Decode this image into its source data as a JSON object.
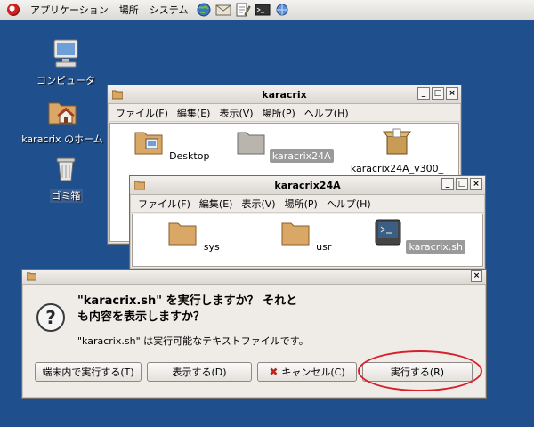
{
  "panel": {
    "menus": [
      "アプリケーション",
      "場所",
      "システム"
    ],
    "launchers": [
      "web-browser-icon",
      "email-icon",
      "text-editor-icon",
      "terminal-icon",
      "network-icon"
    ]
  },
  "desktop": {
    "icons": [
      {
        "label": "コンピュータ",
        "icon": "computer-icon"
      },
      {
        "label": "karacrix のホーム",
        "icon": "home-folder-icon"
      },
      {
        "label": "ゴミ箱",
        "icon": "trash-icon"
      }
    ]
  },
  "win1": {
    "title": "karacrix",
    "menu": [
      "ファイル(F)",
      "編集(E)",
      "表示(V)",
      "場所(P)",
      "ヘルプ(H)"
    ],
    "files": [
      "Desktop",
      "karacrix24A",
      "karacrix24A_v300_"
    ]
  },
  "win2": {
    "title": "karacrix24A",
    "menu": [
      "ファイル(F)",
      "編集(E)",
      "表示(V)",
      "場所(P)",
      "ヘルプ(H)"
    ],
    "files": [
      "sys",
      "usr",
      "karacrix.sh"
    ]
  },
  "dialog": {
    "heading_line1": "\"karacrix.sh\" を実行しますか？ それと",
    "heading_line2": "も内容を表示しますか？",
    "subtext": "\"karacrix.sh\" は実行可能なテキストファイルです。",
    "buttons": {
      "run_in_terminal": "端末内で実行する(T)",
      "display": "表示する(D)",
      "cancel": "キャンセル(C)",
      "run": "実行する(R)"
    }
  },
  "colors": {
    "desktop": "#1f4f8d",
    "highlight_ring": "#d6202a",
    "folder": "#d9a867"
  }
}
